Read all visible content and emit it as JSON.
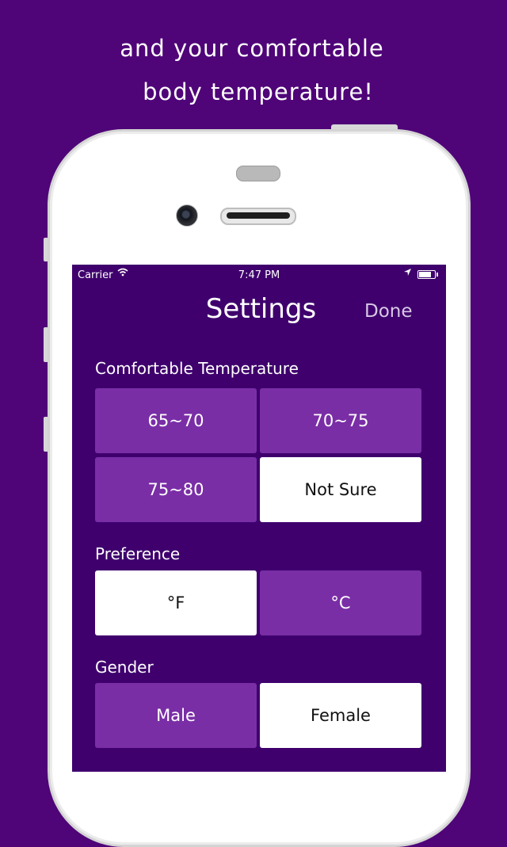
{
  "caption": {
    "line1": "and your comfortable",
    "line2": "body temperature!"
  },
  "status_bar": {
    "carrier": "Carrier",
    "wifi_icon": "wifi-icon",
    "time": "7:47 PM",
    "location_icon": "location-arrow-icon",
    "battery_icon": "battery-icon"
  },
  "nav": {
    "title": "Settings",
    "done_label": "Done"
  },
  "temperature": {
    "label": "Comfortable Temperature",
    "options": [
      "65~70",
      "70~75",
      "75~80",
      "Not Sure"
    ],
    "selected": "Not Sure"
  },
  "preference": {
    "label": "Preference",
    "options": [
      "°F",
      "°C"
    ],
    "selected": "°F"
  },
  "gender": {
    "label": "Gender",
    "options": [
      "Male",
      "Female"
    ],
    "selected": "Female"
  },
  "colors": {
    "background": "#4f0478",
    "screen": "#3f006d",
    "option_unselected": "#7a2ea6",
    "option_selected": "#ffffff"
  }
}
